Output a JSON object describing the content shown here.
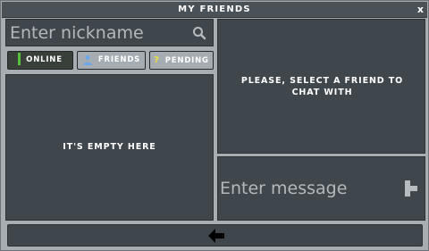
{
  "window": {
    "title": "MY FRIENDS",
    "close_label": "x"
  },
  "search": {
    "placeholder": "Enter nickname"
  },
  "tabs": [
    {
      "label": "ONLINE",
      "indicator_color": "#58c23d"
    },
    {
      "label": "FRIENDS",
      "icon": "friend-icon",
      "icon_color": "#6ea7e6"
    },
    {
      "label": "PENDING",
      "icon": "question-icon",
      "icon_color": "#f4df3a"
    }
  ],
  "friends_list": {
    "empty_text": "IT'S EMPTY HERE"
  },
  "chat": {
    "prompt": "PLEASE, SELECT A FRIEND TO CHAT WITH"
  },
  "message": {
    "placeholder": "Enter message"
  },
  "footer": {
    "back_icon": "arrow-left-icon"
  },
  "colors": {
    "window_bg": "#a7adb1",
    "panel_bg": "#40474c",
    "titlebar_bg": "#4b5257",
    "text": "#ffffff",
    "active_tab_bg": "#39403a",
    "inactive_tab_bg": "#a6adb2"
  }
}
